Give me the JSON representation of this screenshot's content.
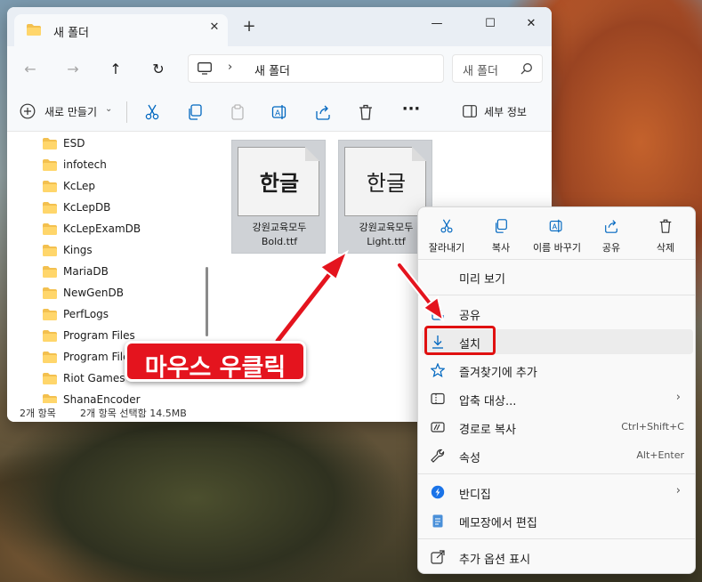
{
  "window": {
    "tab_title": "새 폴더",
    "tab_close": "✕",
    "new_tab": "+",
    "minimize": "—",
    "maximize": "☐",
    "close": "✕"
  },
  "address": {
    "path": "새 폴더",
    "chevron": "›",
    "search_placeholder": "새 폴더"
  },
  "nav_buttons": {
    "back": "←",
    "forward": "→",
    "up": "↑",
    "refresh": "↻"
  },
  "toolbar": {
    "new_label": "새로 만들기",
    "new_dropdown": "⌄",
    "more": "···",
    "details_label": "세부 정보"
  },
  "nav_items": [
    "ESD",
    "infotech",
    "KcLep",
    "KcLepDB",
    "KcLepExamDB",
    "Kings",
    "MariaDB",
    "NewGenDB",
    "PerfLogs",
    "Program Files",
    "Program Files",
    "Riot Games",
    "ShanaEncoder"
  ],
  "files": [
    {
      "glyph": "한글",
      "line1": "강원교육모두",
      "line2": "Bold.ttf"
    },
    {
      "glyph": "한글",
      "line1": "강원교육모두",
      "line2": "Light.ttf"
    }
  ],
  "status": {
    "count": "2개 항목",
    "selection": "2개 항목 선택함 14.5MB"
  },
  "context_menu": {
    "quick_actions": [
      {
        "label": "잘라내기",
        "icon": "scissors-icon"
      },
      {
        "label": "복사",
        "icon": "copy-icon"
      },
      {
        "label": "이름 바꾸기",
        "icon": "rename-icon"
      },
      {
        "label": "공유",
        "icon": "share-icon"
      },
      {
        "label": "삭제",
        "icon": "trash-icon"
      }
    ],
    "items": [
      {
        "label": "미리 보기"
      },
      {
        "label": "공유",
        "icon": "share-icon"
      },
      {
        "label": "설치",
        "icon": "install-download-icon"
      },
      {
        "label": "즐겨찾기에 추가",
        "icon": "star-icon"
      },
      {
        "label": "압축 대상...",
        "icon": "zip-folder-icon",
        "arrow": "›"
      },
      {
        "label": "경로로 복사",
        "icon": "copy-path-icon",
        "shortcut": "Ctrl+Shift+C"
      },
      {
        "label": "속성",
        "icon": "wrench-icon",
        "shortcut": "Alt+Enter"
      },
      {
        "label": "반디집",
        "icon": "bandizip-icon",
        "arrow": "›"
      },
      {
        "label": "메모장에서 편집",
        "icon": "notepad-icon"
      },
      {
        "label": "추가 옵션 표시",
        "icon": "open-external-icon"
      }
    ]
  },
  "annotation": {
    "text": "마우스 우클릭",
    "color": "#e4141e"
  },
  "colors": {
    "accent": "#0067c0",
    "folder": "#f3c04f",
    "highlight_border": "#e01010"
  }
}
